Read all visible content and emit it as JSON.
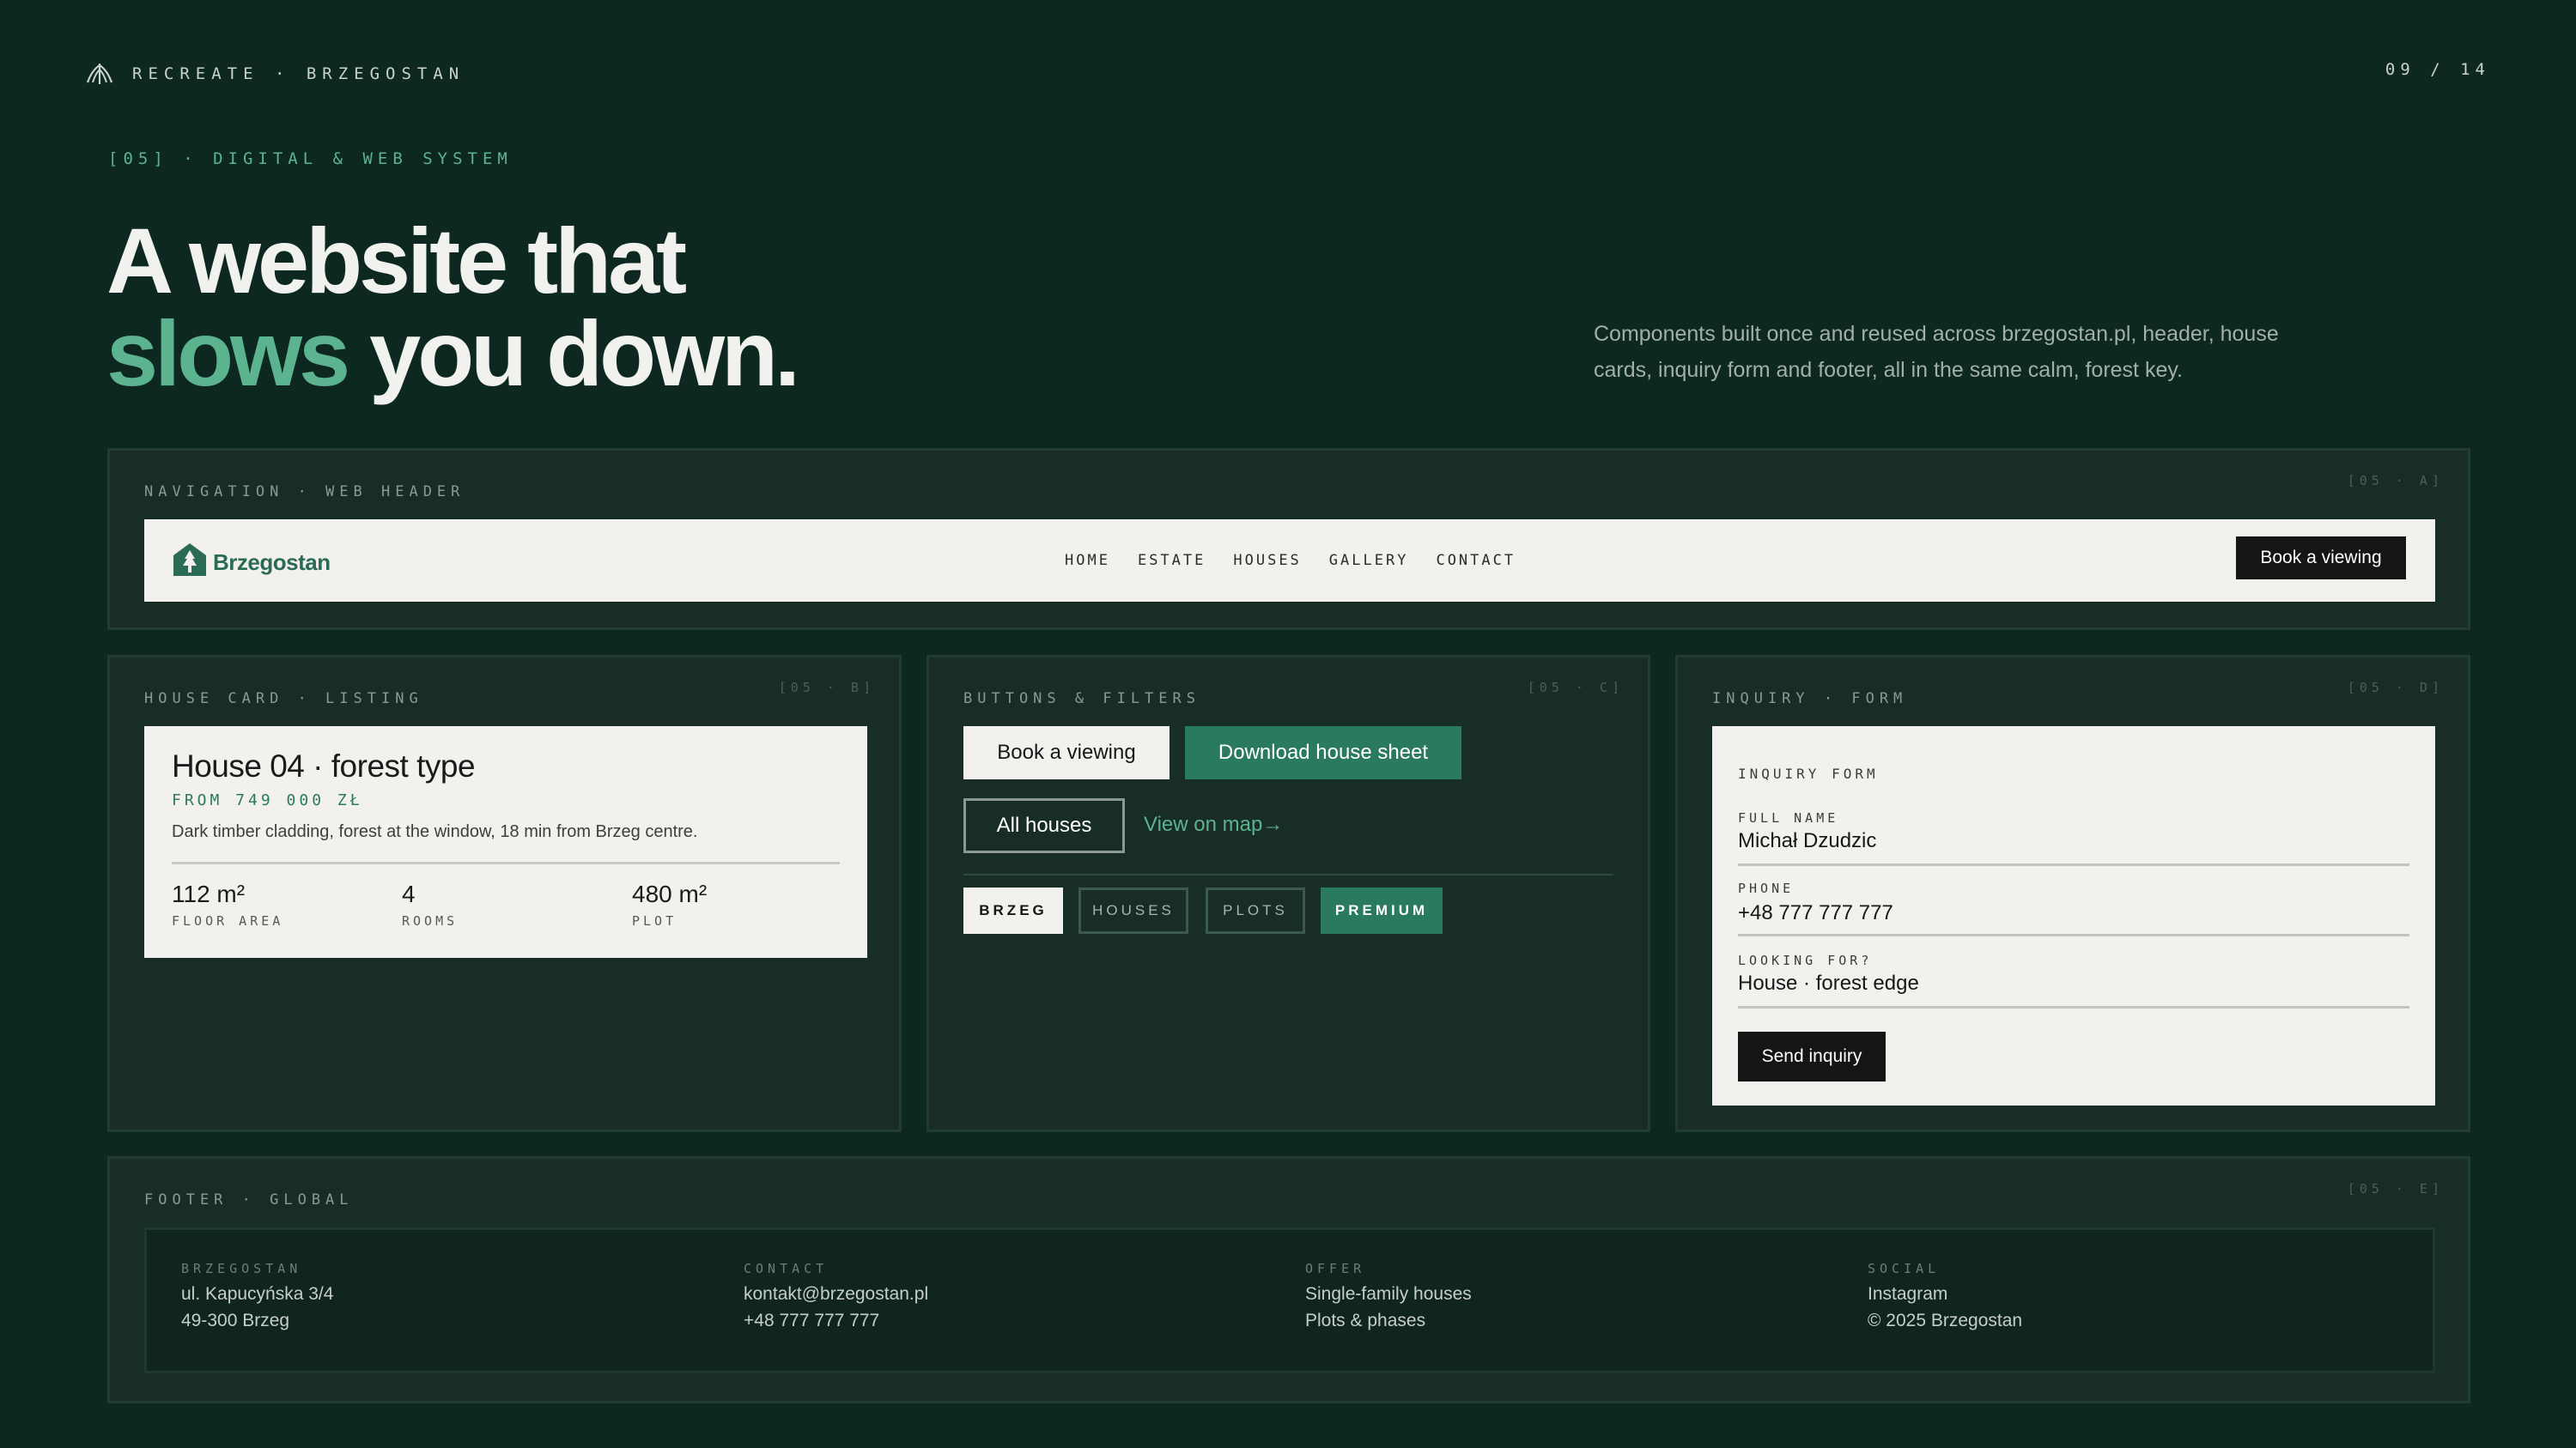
{
  "topbar": {
    "brand": "RECREATE · BRZEGOSTAN",
    "page": "09 / 14"
  },
  "section_tag": "[05] · DIGITAL & WEB SYSTEM",
  "headline": {
    "line1": "A website that",
    "accent": "slows",
    "rest": " you down."
  },
  "intro": "Components built once and reused across brzegostan.pl, header, house cards, inquiry form and footer, all in the same calm, forest key.",
  "colors": {
    "background": "#0d2821",
    "panel": "#172d26",
    "accent": "#5cb38f",
    "brand_green": "#2a7a5e",
    "light": "#f2f1ee",
    "dark": "#151515"
  },
  "nav_panel": {
    "label": "NAVIGATION · WEB HEADER",
    "code": "[05 · A]",
    "logo": "Brzegostan",
    "links": [
      "HOME",
      "ESTATE",
      "HOUSES",
      "GALLERY",
      "CONTACT"
    ],
    "cta": "Book a viewing"
  },
  "card_panel": {
    "label": "HOUSE CARD · LISTING",
    "code": "[05 · B]",
    "title": "House 04 · forest type",
    "price": "FROM 749 000 ZŁ",
    "description": "Dark timber cladding, forest at the window, 18 min from Brzeg centre.",
    "stats": [
      {
        "value": "112 m²",
        "label": "FLOOR AREA"
      },
      {
        "value": "4",
        "label": "ROOMS"
      },
      {
        "value": "480 m²",
        "label": "PLOT"
      }
    ]
  },
  "buttons_panel": {
    "label": "BUTTONS & FILTERS",
    "code": "[05 · C]",
    "primary_light": "Book a viewing",
    "primary_green": "Download house sheet",
    "outline": "All houses",
    "link": "View on map→",
    "filters": [
      "BRZEG",
      "HOUSES",
      "PLOTS",
      "PREMIUM"
    ]
  },
  "form_panel": {
    "label": "INQUIRY · FORM",
    "code": "[05 · D]",
    "title": "INQUIRY FORM",
    "fields": [
      {
        "label": "FULL NAME",
        "value": "Michał Dzudzic"
      },
      {
        "label": "PHONE",
        "value": "+48 777 777 777"
      },
      {
        "label": "LOOKING FOR?",
        "value": "House · forest edge"
      }
    ],
    "submit": "Send inquiry"
  },
  "footer_panel": {
    "label": "FOOTER · GLOBAL",
    "code": "[05 · E]",
    "columns": [
      {
        "head": "BRZEGOSTAN",
        "lines": [
          "ul. Kapucyńska 3/4",
          "49-300 Brzeg"
        ]
      },
      {
        "head": "CONTACT",
        "lines": [
          "kontakt@brzegostan.pl",
          "+48 777 777 777"
        ]
      },
      {
        "head": "OFFER",
        "lines": [
          "Single-family houses",
          "Plots & phases"
        ]
      },
      {
        "head": "SOCIAL",
        "lines": [
          "Instagram",
          "© 2025 Brzegostan"
        ]
      }
    ]
  },
  "icons": {
    "brand": "leaf-mark-icon",
    "logo": "tree-house-icon"
  }
}
